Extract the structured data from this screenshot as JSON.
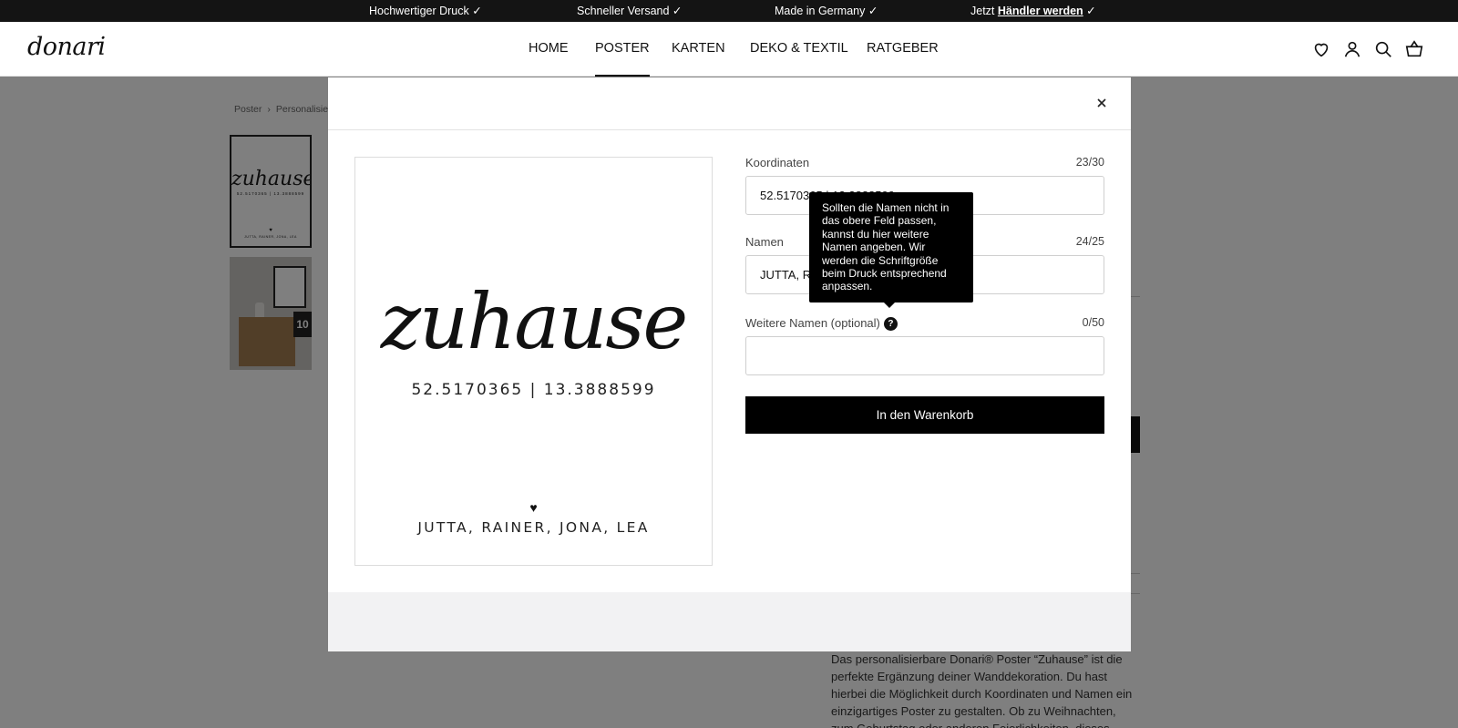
{
  "topbar": {
    "usp1": "Hochwertiger Druck ✓",
    "usp2": "Schneller Versand ✓",
    "usp3": "Made in Germany ✓",
    "usp4_prefix": "Jetzt",
    "usp4_link": "Händler werden",
    "usp4_suffix": "✓"
  },
  "header": {
    "logo": "donari",
    "nav": [
      "HOME",
      "POSTER",
      "KARTEN",
      "DEKO & TEXTIL",
      "RATGEBER"
    ],
    "active_nav": "POSTER",
    "icons": [
      "heart-icon",
      "account-icon",
      "search-icon",
      "basket-icon"
    ]
  },
  "page": {
    "breadcrumb": [
      "Poster",
      "Personalisie"
    ],
    "description": "Das personalisierbare Donari® Poster “Zuhause” ist die perfekte Ergänzung deiner Wanddekoration. Du hast hierbei die Möglichkeit durch Koordinaten und Namen ein einzigartiges Poster zu gestalten. Ob zu Weihnachten, zum Geburtstag oder anderen Feierlichkeiten, dieses"
  },
  "modal": {
    "preview": {
      "word": "zuhause",
      "coordinates": "52.5170365 | 13.3888599",
      "heart": "♥",
      "names": "JUTTA, RAINER, JONA, LEA"
    },
    "fields": {
      "koordinaten": {
        "label": "Koordinaten",
        "count": "23/30",
        "value": "52.5170365 | 13.3888599"
      },
      "namen": {
        "label": "Namen",
        "count": "24/25",
        "value": "JUTTA, RAINER, JONA, LEA"
      },
      "weitere": {
        "label": "Weitere Namen (optional)",
        "count": "0/50",
        "value": ""
      }
    },
    "tooltip": "Sollten die Namen nicht in das obere Feld passen, kannst du hier weitere Namen angeben. Wir werden die Schriftgröße beim Druck entsprechend anpassen.",
    "help_symbol": "?",
    "cart_button": "In den Warenkorb",
    "close_symbol": "close-icon"
  },
  "colors": {
    "topbar_bg": "#141414",
    "button_bg": "#000000",
    "overlay": "rgba(0,0,0,0.5)"
  }
}
